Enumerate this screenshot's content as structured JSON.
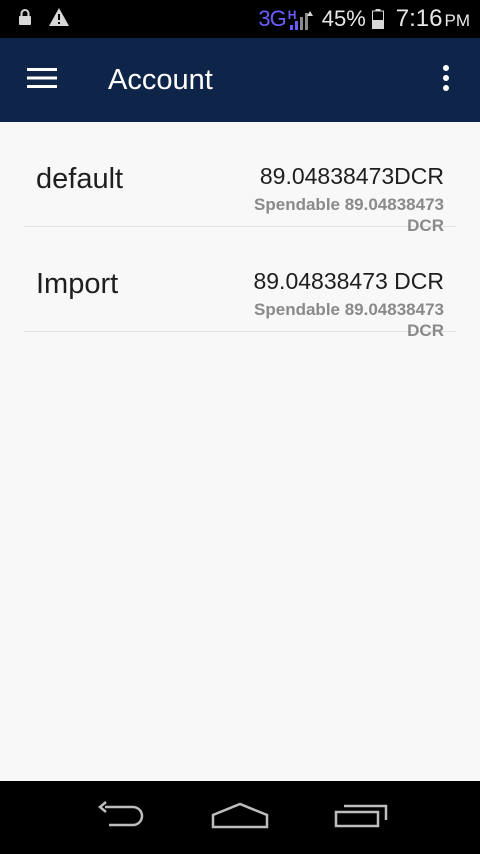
{
  "status_bar": {
    "network_type": "3G",
    "network_subtype": "H",
    "battery_percent": "45%",
    "time": "7:16",
    "ampm": "PM",
    "icons": [
      "lock-icon",
      "warning-icon",
      "signal-icon",
      "battery-icon"
    ]
  },
  "app_bar": {
    "title": "Account",
    "background_color": "#0f2449",
    "icons": [
      "hamburger-menu-icon",
      "overflow-menu-icon"
    ]
  },
  "accounts": [
    {
      "name": "default",
      "balance": "89.04838473DCR",
      "spendable": "Spendable 89.04838473 DCR"
    },
    {
      "name": "Import",
      "balance": "89.04838473 DCR",
      "spendable": "Spendable 89.04838473 DCR"
    }
  ],
  "nav_bar": {
    "icons": [
      "back-icon",
      "home-icon",
      "recent-apps-icon"
    ]
  }
}
